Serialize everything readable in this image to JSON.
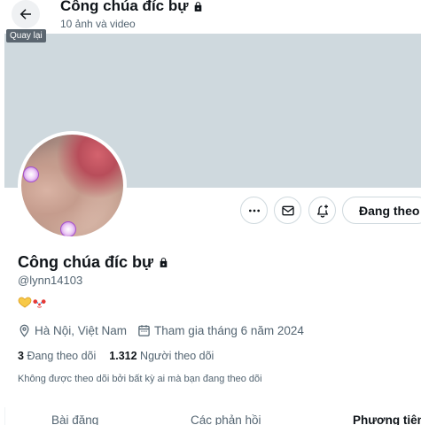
{
  "header": {
    "back_tooltip": "Quay lại",
    "title": "Công chúa đíc bự",
    "subtitle": "10 ảnh và video"
  },
  "profile": {
    "name": "Công chúa đíc bự",
    "handle": "@lynn14103",
    "bio_emojis": [
      "yellow-heart-hands",
      "clown-face"
    ],
    "location": "Hà Nội, Việt Nam",
    "joined": "Tham gia tháng 6 năm 2024",
    "following_count": "3",
    "following_label": "Đang theo dõi",
    "followers_count": "1.312",
    "followers_label": "Người theo dõi",
    "followed_by_note": "Không được theo dõi bởi bất kỳ ai mà bạn đang theo dõi"
  },
  "actions": {
    "follow_label": "Đang theo",
    "more_icon": "more-horizontal-icon",
    "message_icon": "envelope-icon",
    "notify_icon": "bell-plus-icon"
  },
  "tabs": [
    {
      "label": "Bài đăng"
    },
    {
      "label": "Các phản hồi"
    },
    {
      "label": "Phương tiện"
    }
  ],
  "colors": {
    "banner": "#cfd9de",
    "secondary_text": "#536471",
    "primary_text": "#0f1419"
  }
}
